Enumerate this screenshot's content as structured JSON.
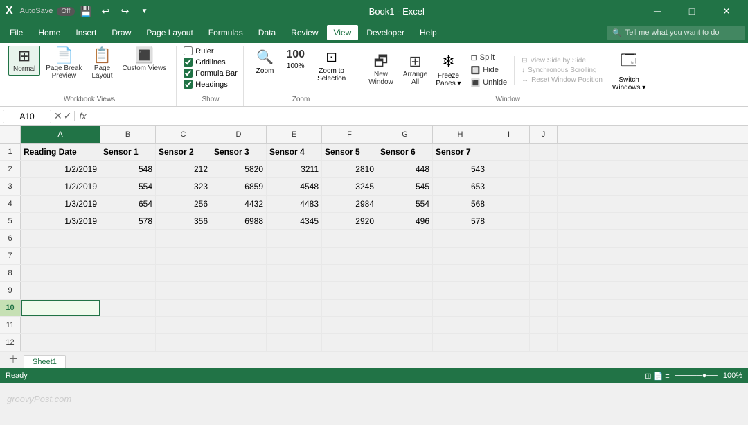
{
  "titleBar": {
    "appName": "Book1 - Excel",
    "autosaveLabel": "AutoSave",
    "autosaveState": "Off",
    "saveIcon": "💾",
    "undoIcon": "↩",
    "redoIcon": "↪",
    "customizeIcon": "⚙",
    "minBtn": "─",
    "maxBtn": "□",
    "closeBtn": "✕"
  },
  "menuBar": {
    "items": [
      "File",
      "Home",
      "Insert",
      "Draw",
      "Page Layout",
      "Formulas",
      "Data",
      "Review",
      "View",
      "Developer",
      "Help"
    ],
    "activeItem": "View",
    "searchPlaceholder": "Tell me what you want to do"
  },
  "ribbon": {
    "groups": {
      "workbookViews": {
        "label": "Workbook Views",
        "normal": "Normal",
        "pageBreak": "Page Break\nPreview",
        "pageLayout": "Page\nLayout",
        "customViews": "Custom\nViews"
      },
      "show": {
        "label": "Show",
        "ruler": "Ruler",
        "gridlines": "Gridlines",
        "formulaBar": "Formula Bar",
        "headings": "Headings",
        "rulerChecked": false,
        "gridlinesChecked": true,
        "formulaBarChecked": true,
        "headingsChecked": true
      },
      "zoom": {
        "label": "Zoom",
        "zoomLabel": "Zoom",
        "zoomPercent": "100%",
        "zoomSelection": "Zoom to\nSelection"
      },
      "window": {
        "label": "Window",
        "newWindow": "New\nWindow",
        "arrangeAll": "Arrange\nAll",
        "freezePanes": "Freeze\nPanes",
        "split": "Split",
        "hide": "Hide",
        "unhide": "Unhide",
        "viewSideBySide": "View Side by Side",
        "synchronousScrolling": "Synchronous Scrolling",
        "resetWindowPosition": "Reset Window Position",
        "switchWindows": "Switch\nWindows"
      }
    }
  },
  "formulaBar": {
    "cellRef": "A10",
    "fxLabel": "fx"
  },
  "columns": [
    "A",
    "B",
    "C",
    "D",
    "E",
    "F",
    "G",
    "H",
    "I",
    "J"
  ],
  "headers": [
    "Reading Date",
    "Sensor 1",
    "Sensor 2",
    "Sensor 3",
    "Sensor 4",
    "Sensor 5",
    "Sensor 6",
    "Sensor 7"
  ],
  "rows": [
    {
      "num": 2,
      "data": [
        "1/2/2019",
        "548",
        "212",
        "5820",
        "3211",
        "2810",
        "448",
        "543"
      ]
    },
    {
      "num": 3,
      "data": [
        "1/2/2019",
        "554",
        "323",
        "6859",
        "4548",
        "3245",
        "545",
        "653"
      ]
    },
    {
      "num": 4,
      "data": [
        "1/3/2019",
        "654",
        "256",
        "4432",
        "4483",
        "2984",
        "554",
        "568"
      ]
    },
    {
      "num": 5,
      "data": [
        "1/3/2019",
        "578",
        "356",
        "6988",
        "4345",
        "2920",
        "496",
        "578"
      ]
    },
    {
      "num": 6,
      "data": [
        "",
        "",
        "",
        "",
        "",
        "",
        "",
        ""
      ]
    },
    {
      "num": 7,
      "data": [
        "",
        "",
        "",
        "",
        "",
        "",
        "",
        ""
      ]
    },
    {
      "num": 8,
      "data": [
        "",
        "",
        "",
        "",
        "",
        "",
        "",
        ""
      ]
    },
    {
      "num": 9,
      "data": [
        "",
        "",
        "",
        "",
        "",
        "",
        "",
        ""
      ]
    },
    {
      "num": 10,
      "data": [
        "",
        "",
        "",
        "",
        "",
        "",
        "",
        ""
      ]
    },
    {
      "num": 11,
      "data": [
        "",
        "",
        "",
        "",
        "",
        "",
        "",
        ""
      ]
    },
    {
      "num": 12,
      "data": [
        "",
        "",
        "",
        "",
        "",
        "",
        "",
        ""
      ]
    }
  ],
  "selectedCell": {
    "row": 10,
    "col": 0
  },
  "sheetTabs": {
    "active": "Sheet1",
    "tabs": [
      "Sheet1"
    ]
  },
  "statusBar": {
    "mode": "Ready",
    "zoom": "100%",
    "zoomSlider": "─────●──"
  },
  "watermark": "groovyPost.com"
}
